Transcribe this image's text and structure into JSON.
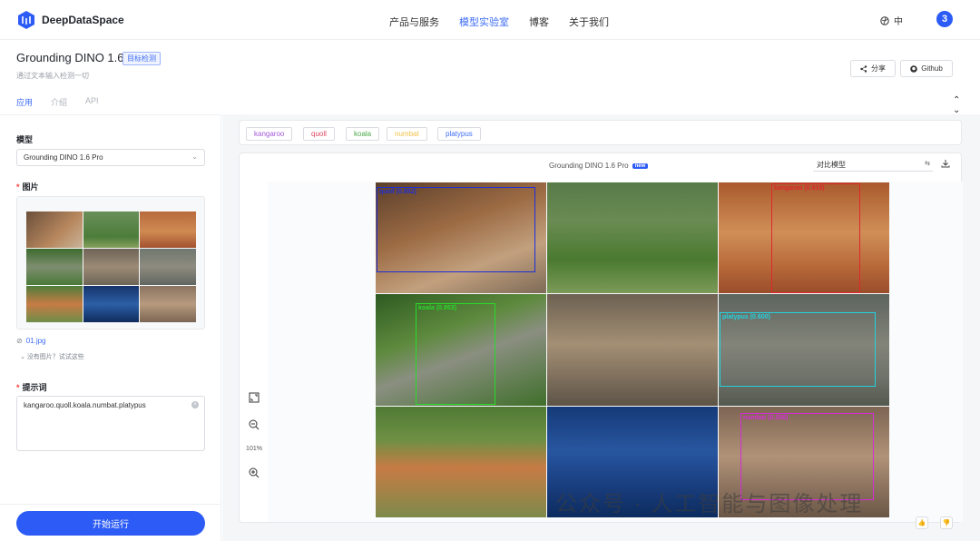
{
  "brand": {
    "name": "DeepDataSpace"
  },
  "nav": {
    "items": [
      "产品与服务",
      "模型实验室",
      "博客",
      "关于我们"
    ]
  },
  "header": {
    "lang": "中",
    "avatar_initial": "3"
  },
  "page": {
    "title": "Grounding DINO 1.6",
    "tag": "目标检测",
    "subtitle": "通过文本输入检测一切",
    "share_label": "分享",
    "github_label": "Github",
    "tabs": [
      "应用",
      "介绍",
      "API"
    ]
  },
  "left": {
    "model_label": "模型",
    "model_value": "Grounding DINO 1.6 Pro",
    "image_label": "图片",
    "file_name": "01.jpg",
    "hint": "没有图片？试试这些",
    "prompt_label": "提示词",
    "prompt_value": "kangaroo.quoll.koala.numbat.platypus",
    "run_label": "开始运行"
  },
  "right": {
    "chips": [
      {
        "label": "kangaroo",
        "color": "#a259d9"
      },
      {
        "label": "quoll",
        "color": "#e0445f"
      },
      {
        "label": "koala",
        "color": "#4aa84a"
      },
      {
        "label": "numbat",
        "color": "#f0c24a"
      },
      {
        "label": "platypus",
        "color": "#3f6df5"
      }
    ],
    "card_title": "Grounding DINO 1.6 Pro",
    "new_badge": "new",
    "compare_placeholder": "对比模型",
    "zoom": "101%"
  },
  "detections": {
    "quoll": {
      "label": "quoll (0.852)",
      "color": "#1e2fd6"
    },
    "kangaroo": {
      "label": "kangaroo (0.919)",
      "color": "#e0262d"
    },
    "koala": {
      "label": "koala (0.853)",
      "color": "#2bd92b"
    },
    "platypus": {
      "label": "platypus (0.600)",
      "color": "#22d3e0"
    },
    "numbat": {
      "label": "numbat (0.258)",
      "color": "#d62bd6"
    }
  },
  "watermark": "公众号 · 人工智能与图像处理"
}
